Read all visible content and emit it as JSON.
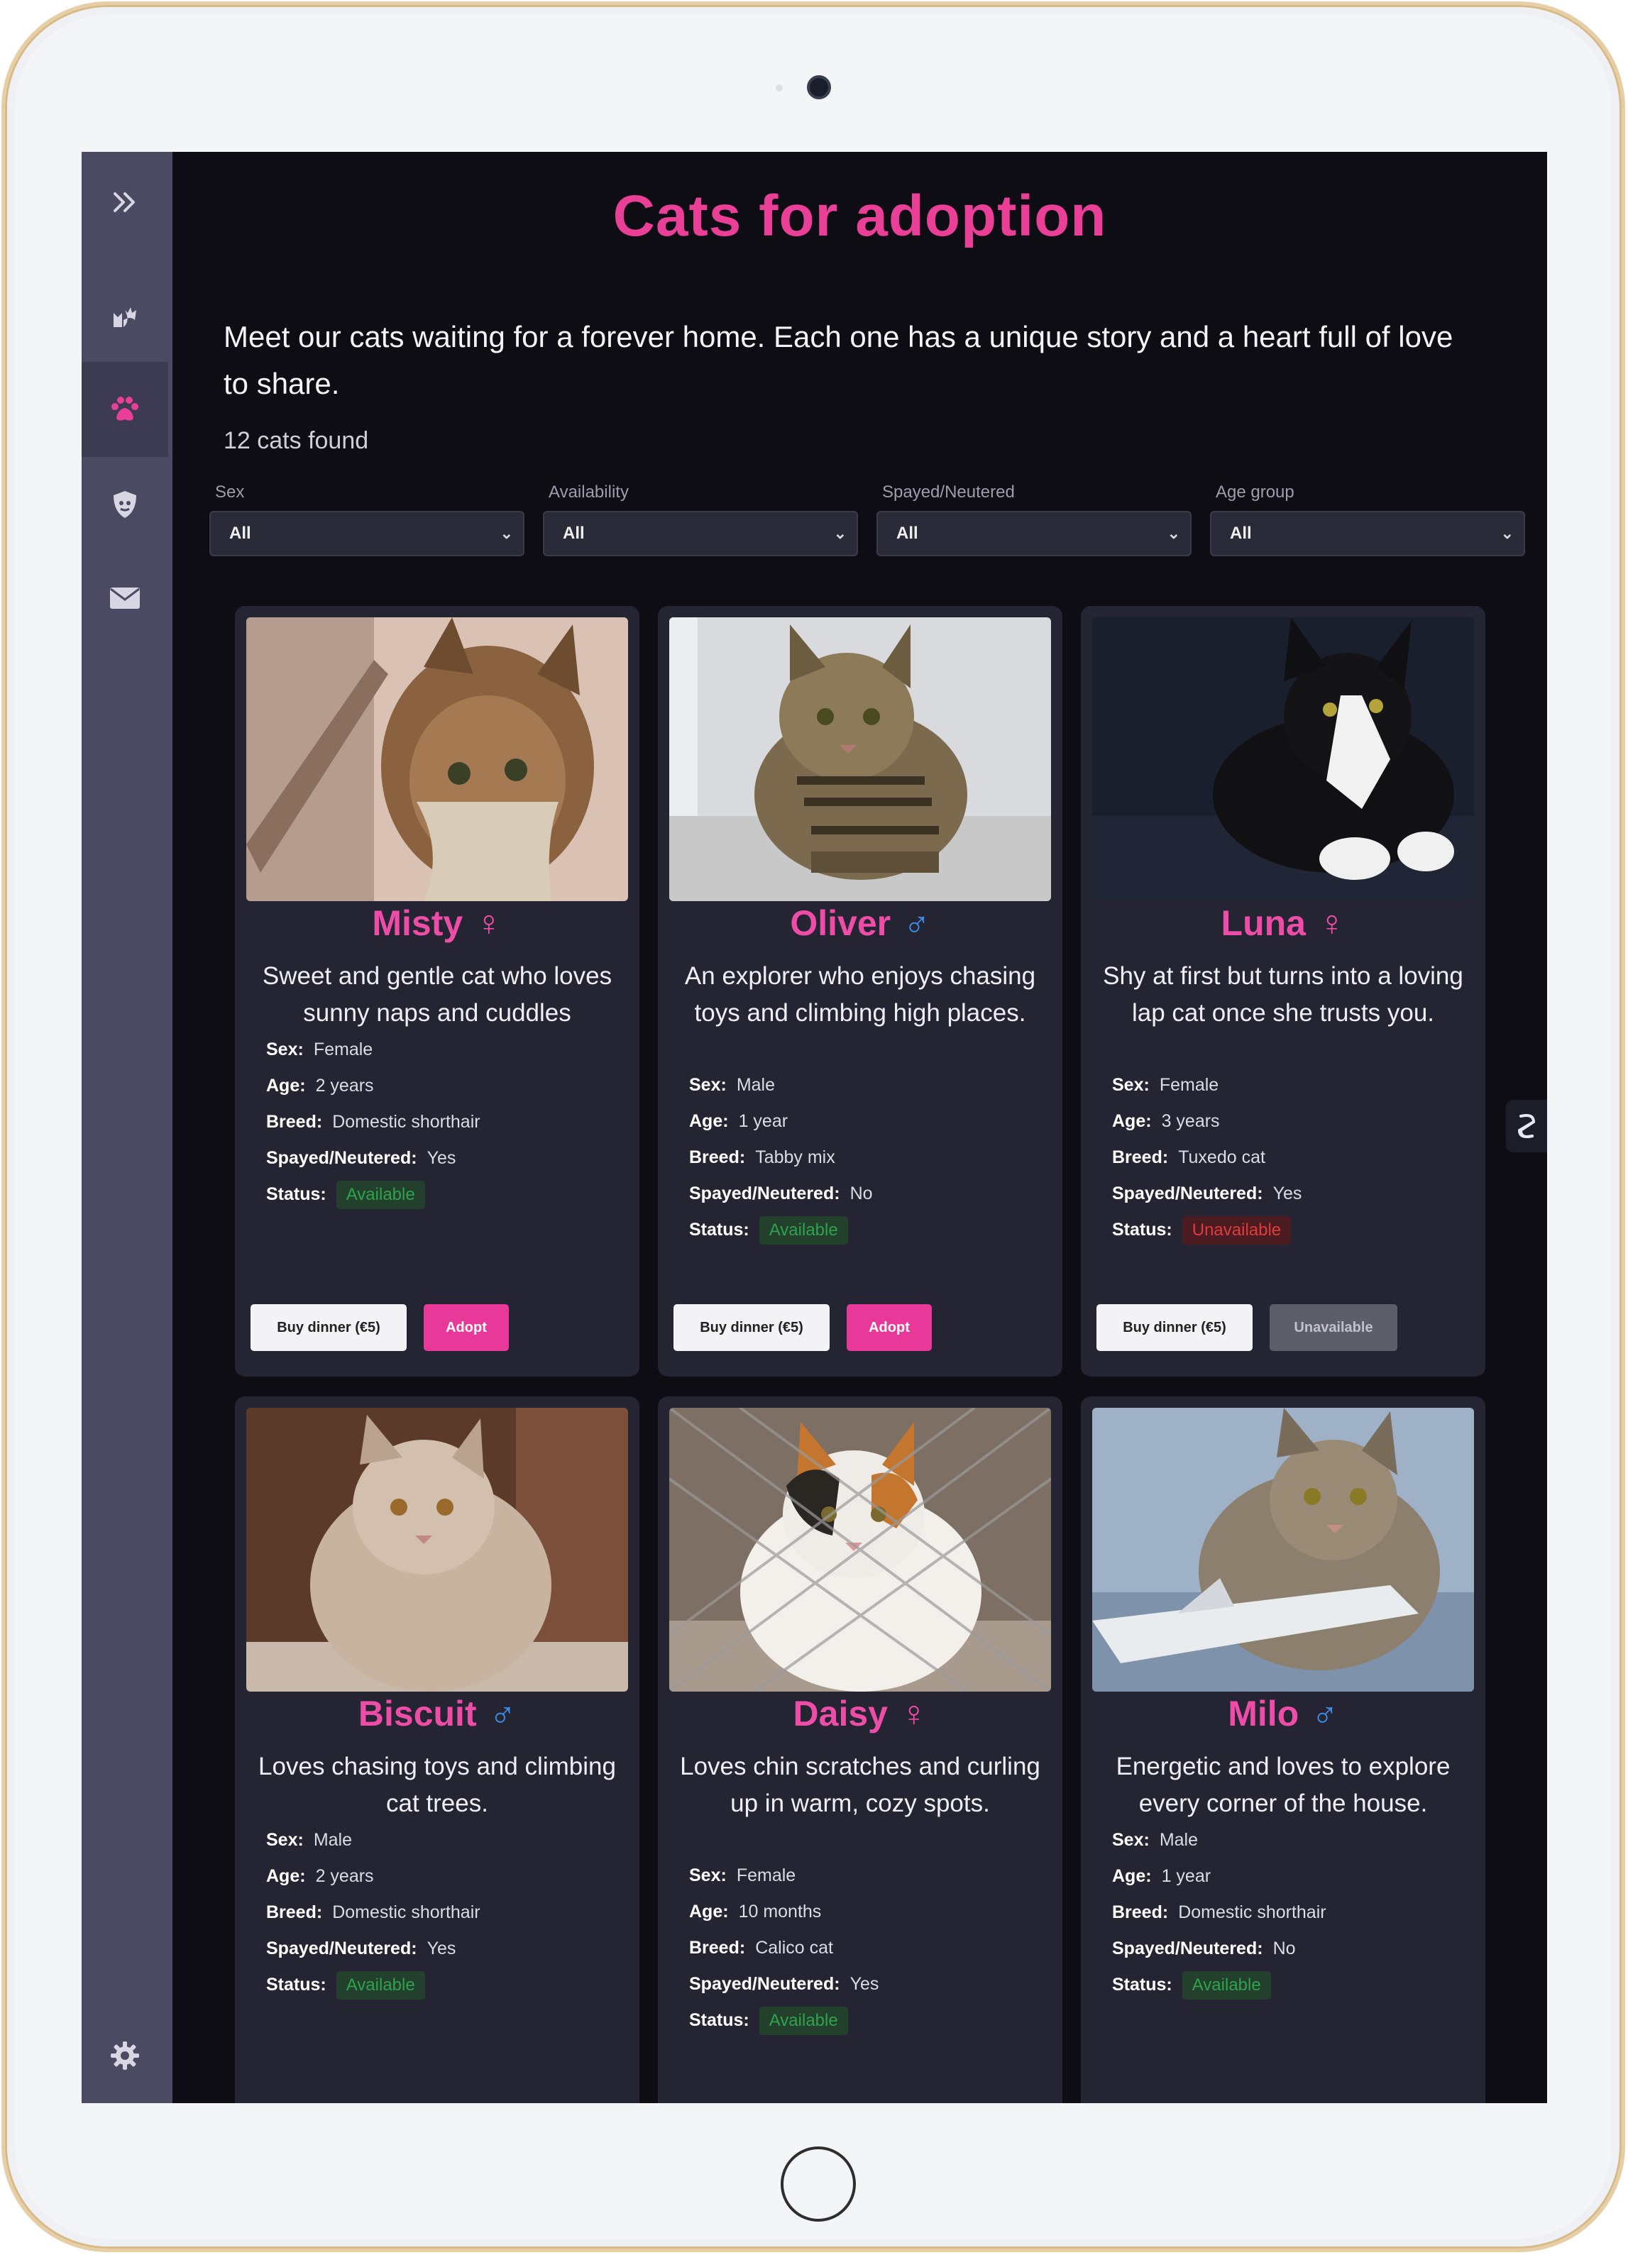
{
  "page": {
    "title": "Cats for adoption",
    "intro": "Meet our cats waiting for a forever home. Each one has a unique story and a heart full of love to share.",
    "count": "12 cats found"
  },
  "sidebar": {
    "items": [
      {
        "icon": "expand-icon"
      },
      {
        "icon": "cat-icon"
      },
      {
        "icon": "paw-icon",
        "active": true
      },
      {
        "icon": "shield-icon"
      },
      {
        "icon": "mail-icon"
      },
      {
        "icon": "gear-icon"
      }
    ]
  },
  "filters": [
    {
      "label": "Sex",
      "value": "All"
    },
    {
      "label": "Availability",
      "value": "All"
    },
    {
      "label": "Spayed/Neutered",
      "value": "All"
    },
    {
      "label": "Age group",
      "value": "All"
    }
  ],
  "labels": {
    "sex": "Sex:",
    "age": "Age:",
    "breed": "Breed:",
    "spayed": "Spayed/Neutered:",
    "status": "Status:",
    "dinner": "Buy dinner (€5)",
    "adopt": "Adopt",
    "unavailable": "Unavailable"
  },
  "cats": [
    {
      "name": "Misty",
      "sex_symbol": "♀",
      "description": "Sweet and gentle cat who loves sunny naps and cuddles",
      "sex": "Female",
      "age": "2 years",
      "breed": "Domestic shorthair",
      "spayed": "Yes",
      "status": "Available"
    },
    {
      "name": "Oliver",
      "sex_symbol": "♂",
      "description": "An explorer who enjoys chasing toys and climbing high places.",
      "sex": "Male",
      "age": "1 year",
      "breed": "Tabby mix",
      "spayed": "No",
      "status": "Available"
    },
    {
      "name": "Luna",
      "sex_symbol": "♀",
      "description": "Shy at first but turns into a loving lap cat once she trusts you.",
      "sex": "Female",
      "age": "3 years",
      "breed": "Tuxedo cat",
      "spayed": "Yes",
      "status": "Unavailable"
    },
    {
      "name": "Biscuit",
      "sex_symbol": "♂",
      "description": "Loves chasing toys and climbing cat trees.",
      "sex": "Male",
      "age": "2 years",
      "breed": "Domestic shorthair",
      "spayed": "Yes",
      "status": "Available"
    },
    {
      "name": "Daisy",
      "sex_symbol": "♀",
      "description": "Loves chin scratches and curling up in warm, cozy spots.",
      "sex": "Female",
      "age": "10 months",
      "breed": "Calico cat",
      "spayed": "Yes",
      "status": "Available"
    },
    {
      "name": "Milo",
      "sex_symbol": "♂",
      "description": "Energetic and loves to explore every corner of the house.",
      "sex": "Male",
      "age": "1 year",
      "breed": "Domestic shorthair",
      "spayed": "No",
      "status": "Available"
    }
  ],
  "colors": {
    "accent": "#ea3f97",
    "male": "#3d8ee8",
    "available": "#2fa24c",
    "unavailable": "#e13a3a",
    "sidebar": "#4b4a62",
    "background": "#0e0d14",
    "card": "#252433"
  }
}
